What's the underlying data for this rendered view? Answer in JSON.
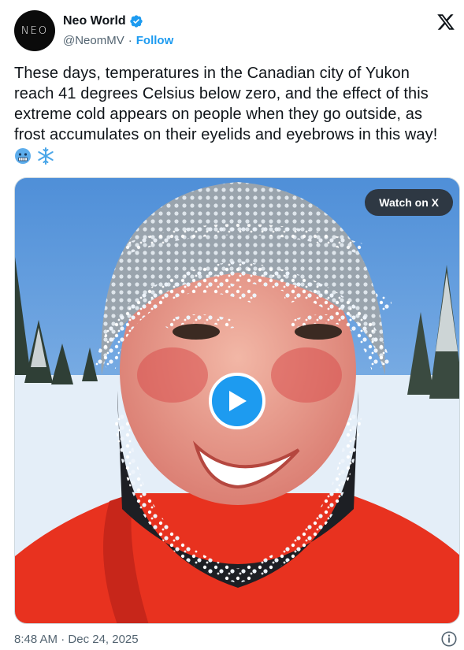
{
  "author": {
    "avatar_text": "NEO",
    "display_name": "Neo World",
    "handle": "@NeomMV",
    "separator": "·",
    "follow_label": "Follow"
  },
  "tweet": {
    "text": "These days, temperatures in the Canadian city of Yukon reach 41 degrees Celsius below zero, and the effect of this extreme cold appears on people when they go outside, as frost accumulates on their eyelids and eyebrows in this way!",
    "emojis": [
      "cold-face-emoji",
      "snowflake-emoji"
    ]
  },
  "media": {
    "watch_label": "Watch on X",
    "type": "video"
  },
  "footer": {
    "time": "8:48 AM",
    "separator": "·",
    "date": "Dec 24, 2025"
  },
  "icons": [
    "verified-badge-icon",
    "x-logo-icon",
    "play-icon",
    "info-icon"
  ],
  "colors": {
    "accent": "#1d9bf0",
    "text": "#0f1419",
    "secondary": "#536471",
    "jacket": "#e8321f"
  }
}
